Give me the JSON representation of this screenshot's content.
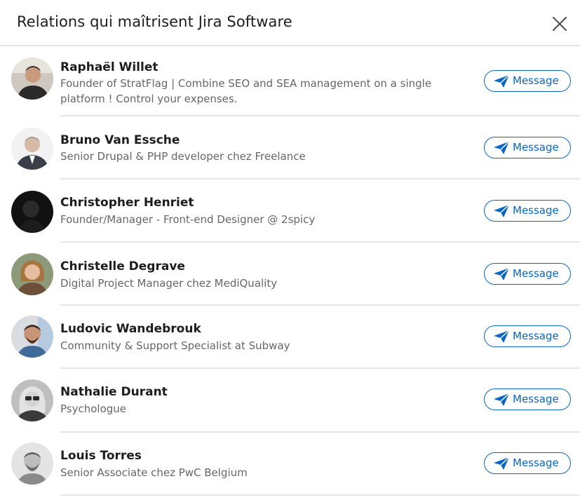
{
  "header": {
    "title": "Relations qui maîtrisent Jira Software",
    "close_icon": "close-icon"
  },
  "colors": {
    "accent": "#0a66c2",
    "name_text": "#1d1d1d",
    "headline_text": "#666666",
    "divider": "#e6e6e6"
  },
  "people": [
    {
      "name": "Raphaël Willet",
      "headline": "Founder of StratFlag | Combine SEO and SEA management on a single platform ! Control your expenses.",
      "button_label": "Message"
    },
    {
      "name": "Bruno Van Essche",
      "headline": "Senior Drupal & PHP developer chez Freelance",
      "button_label": "Message"
    },
    {
      "name": "Christopher Henriet",
      "headline": "Founder/Manager - Front-end Designer @ 2spicy",
      "button_label": "Message"
    },
    {
      "name": "Christelle Degrave",
      "headline": "Digital Project Manager chez MediQuality",
      "button_label": "Message"
    },
    {
      "name": "Ludovic Wandebrouk",
      "headline": "Community & Support Specialist at Subway",
      "button_label": "Message"
    },
    {
      "name": "Nathalie Durant",
      "headline": "Psychologue",
      "button_label": "Message"
    },
    {
      "name": "Louis Torres",
      "headline": "Senior Associate chez PwC Belgium",
      "button_label": "Message"
    }
  ]
}
